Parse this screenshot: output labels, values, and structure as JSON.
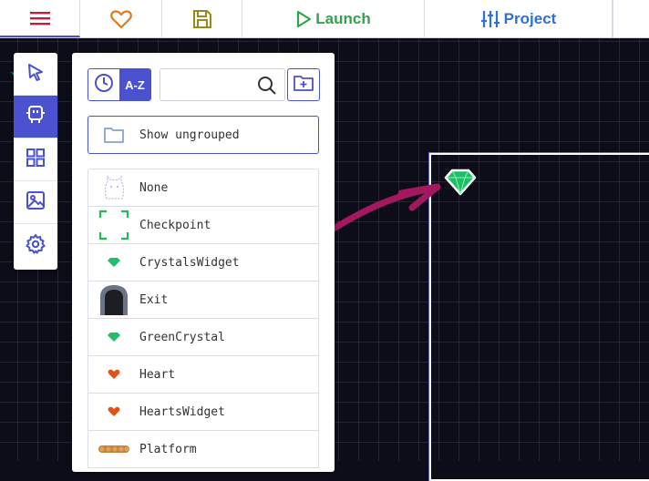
{
  "toolbar": {
    "launch_label": "Launch",
    "project_label": "Project",
    "colors": {
      "menu": "#c0203a",
      "heart": "#e07a1a",
      "save": "#9a8a1a",
      "launch": "#2fa54a",
      "project": "#2f6fd8"
    }
  },
  "tools": [
    {
      "name": "select",
      "icon": "cursor-icon",
      "active": false
    },
    {
      "name": "entities",
      "icon": "robot-icon",
      "active": true
    },
    {
      "name": "tiles",
      "icon": "grid-icon",
      "active": false
    },
    {
      "name": "backgrounds",
      "icon": "image-icon",
      "active": false
    },
    {
      "name": "settings",
      "icon": "gear-icon",
      "active": false
    }
  ],
  "panel": {
    "sort_az_label": "A-Z",
    "search": {
      "value": "",
      "placeholder": ""
    },
    "show_ungrouped_label": "Show ungrouped",
    "items": [
      {
        "label": "None",
        "thumb": "ghost-icon"
      },
      {
        "label": "Checkpoint",
        "thumb": "checkpoint-icon"
      },
      {
        "label": "CrystalsWidget",
        "thumb": "crystal-icon"
      },
      {
        "label": "Exit",
        "thumb": "exit-door-icon"
      },
      {
        "label": "GreenCrystal",
        "thumb": "crystal-icon"
      },
      {
        "label": "Heart",
        "thumb": "heart-icon"
      },
      {
        "label": "HeartsWidget",
        "thumb": "heart-icon"
      },
      {
        "label": "Platform",
        "thumb": "platform-icon"
      }
    ]
  },
  "canvas": {
    "background": "#0c0d18",
    "room_border": "#ffffff",
    "arrow_color": "#a3185e",
    "crystal_color": "#2fd07a"
  }
}
